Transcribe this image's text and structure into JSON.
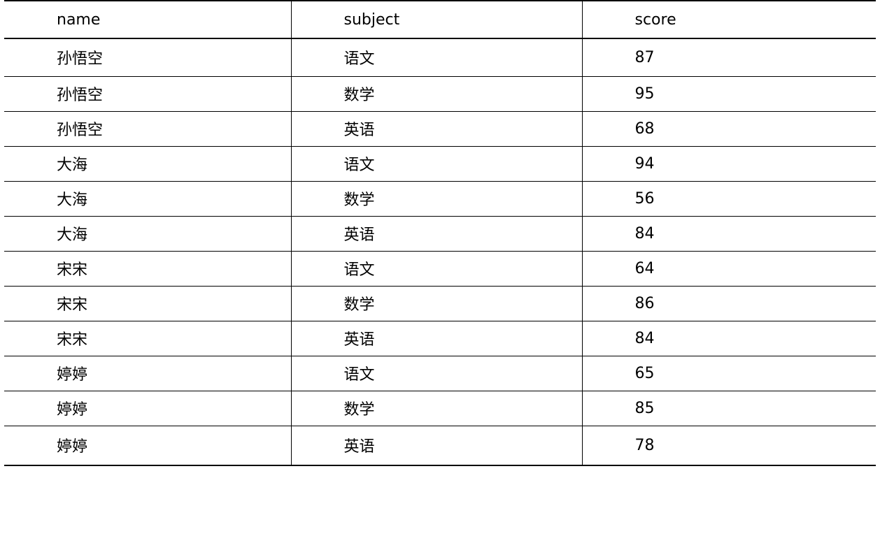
{
  "table": {
    "headers": [
      "name",
      "subject",
      "score"
    ],
    "rows": [
      [
        "孙悟空",
        "语文",
        "87"
      ],
      [
        "孙悟空",
        "数学",
        "95"
      ],
      [
        "孙悟空",
        "英语",
        "68"
      ],
      [
        "大海",
        "语文",
        "94"
      ],
      [
        "大海",
        "数学",
        "56"
      ],
      [
        "大海",
        "英语",
        "84"
      ],
      [
        "宋宋",
        "语文",
        "64"
      ],
      [
        "宋宋",
        "数学",
        "86"
      ],
      [
        "宋宋",
        "英语",
        "84"
      ],
      [
        "婷婷",
        "语文",
        "65"
      ],
      [
        "婷婷",
        "数学",
        "85"
      ],
      [
        "婷婷",
        "英语",
        "78"
      ]
    ]
  }
}
